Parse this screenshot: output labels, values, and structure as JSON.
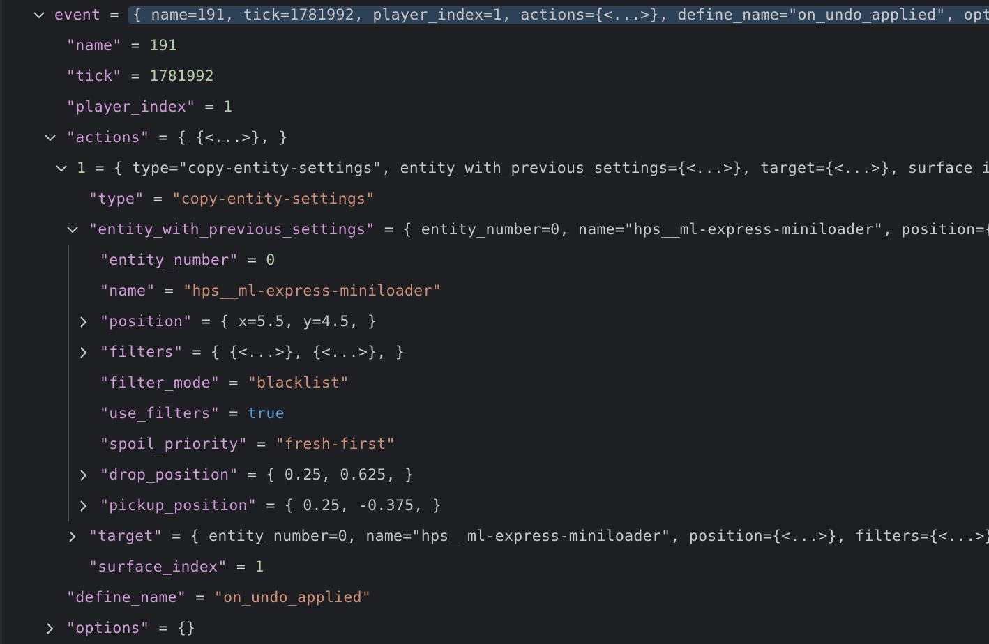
{
  "rows": {
    "event": {
      "key": "event",
      "eq": " = ",
      "preview": "{ name=191, tick=1781992, player_index=1, actions={<...>}, define_name=\"on_undo_applied\", opti"
    },
    "name": {
      "key": "\"name\"",
      "eq": " = ",
      "value": "191"
    },
    "tick": {
      "key": "\"tick\"",
      "eq": " = ",
      "value": "1781992"
    },
    "player_index": {
      "key": "\"player_index\"",
      "eq": " = ",
      "value": "1"
    },
    "actions": {
      "key": "\"actions\"",
      "eq": " = ",
      "preview": "{ {<...>}, }"
    },
    "action_1": {
      "key": "1",
      "eq": " = ",
      "preview": "{ type=\"copy-entity-settings\", entity_with_previous_settings={<...>}, target={<...>}, surface_i"
    },
    "type": {
      "key": "\"type\"",
      "eq": " = ",
      "value": "\"copy-entity-settings\""
    },
    "ewps": {
      "key": "\"entity_with_previous_settings\"",
      "eq": " = ",
      "preview": "{ entity_number=0, name=\"hps__ml-express-miniloader\", position={"
    },
    "entity_number": {
      "key": "\"entity_number\"",
      "eq": " = ",
      "value": "0"
    },
    "ewps_name": {
      "key": "\"name\"",
      "eq": " = ",
      "value": "\"hps__ml-express-miniloader\""
    },
    "position": {
      "key": "\"position\"",
      "eq": " = ",
      "preview": "{ x=5.5, y=4.5, }"
    },
    "filters": {
      "key": "\"filters\"",
      "eq": " = ",
      "preview": "{ {<...>}, {<...>}, }"
    },
    "filter_mode": {
      "key": "\"filter_mode\"",
      "eq": " = ",
      "value": "\"blacklist\""
    },
    "use_filters": {
      "key": "\"use_filters\"",
      "eq": " = ",
      "value": "true"
    },
    "spoil_priority": {
      "key": "\"spoil_priority\"",
      "eq": " = ",
      "value": "\"fresh-first\""
    },
    "drop_position": {
      "key": "\"drop_position\"",
      "eq": " = ",
      "preview": "{ 0.25, 0.625, }"
    },
    "pickup_position": {
      "key": "\"pickup_position\"",
      "eq": " = ",
      "preview": "{ 0.25, -0.375, }"
    },
    "target": {
      "key": "\"target\"",
      "eq": " = ",
      "preview": "{ entity_number=0, name=\"hps__ml-express-miniloader\", position={<...>}, filters={<...>}"
    },
    "surface_index": {
      "key": "\"surface_index\"",
      "eq": " = ",
      "value": "1"
    },
    "define_name": {
      "key": "\"define_name\"",
      "eq": " = ",
      "value": "\"on_undo_applied\""
    },
    "options": {
      "key": "\"options\"",
      "eq": " = ",
      "preview": "{}"
    }
  },
  "icons": {
    "expanded": "chevron-down-icon",
    "collapsed": "chevron-right-icon"
  },
  "colors": {
    "background": "#1e1f22",
    "key": "#ce9cd6",
    "number": "#b5cea8",
    "string": "#ce9178",
    "boolean": "#569cd6",
    "selection": "#2d4256"
  }
}
